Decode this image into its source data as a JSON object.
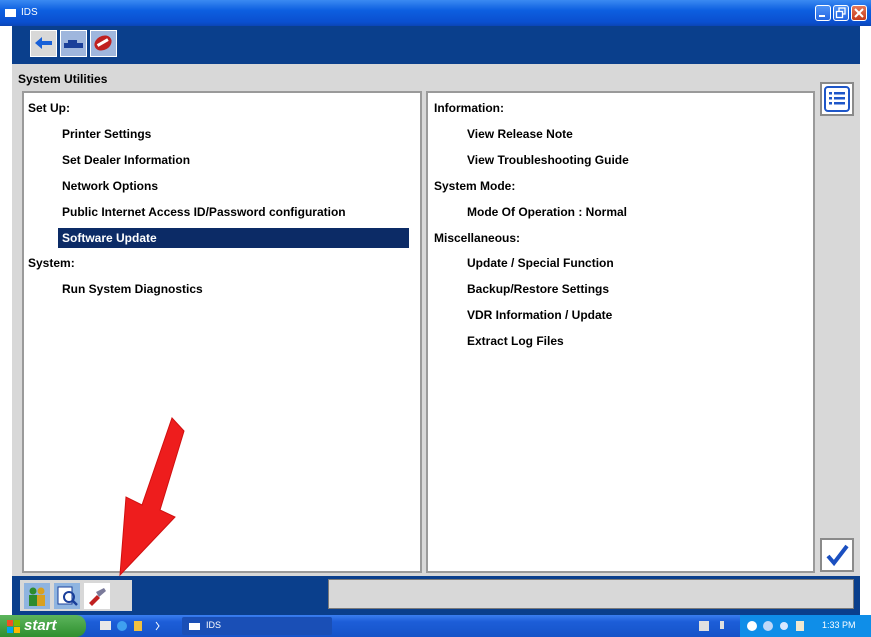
{
  "window": {
    "title": "IDS"
  },
  "toolbar": {
    "icons": [
      "connect-icon",
      "vehicle-icon",
      "tools-icon"
    ]
  },
  "page": {
    "heading": "System Utilities"
  },
  "left_panel": {
    "items": [
      {
        "label": "Set Up:",
        "type": "category"
      },
      {
        "label": "Printer Settings",
        "type": "item"
      },
      {
        "label": "Set Dealer Information",
        "type": "item"
      },
      {
        "label": "Network Options",
        "type": "item"
      },
      {
        "label": "Public Internet Access ID/Password configuration",
        "type": "item"
      },
      {
        "label": "Software Update",
        "type": "item",
        "selected": true
      },
      {
        "label": "System:",
        "type": "category"
      },
      {
        "label": "Run System Diagnostics",
        "type": "item"
      }
    ]
  },
  "right_panel": {
    "items": [
      {
        "label": "Information:",
        "type": "category"
      },
      {
        "label": "View Release Note",
        "type": "item"
      },
      {
        "label": "View Troubleshooting Guide",
        "type": "item"
      },
      {
        "label": "System Mode:",
        "type": "category"
      },
      {
        "label": "Mode Of Operation : Normal",
        "type": "item"
      },
      {
        "label": "Miscellaneous:",
        "type": "category"
      },
      {
        "label": "Update / Special Function",
        "type": "item"
      },
      {
        "label": "Backup/Restore Settings",
        "type": "item"
      },
      {
        "label": "VDR Information / Update",
        "type": "item"
      },
      {
        "label": "Extract Log Files",
        "type": "item"
      }
    ]
  },
  "taskbar": {
    "start_label": "start",
    "task_label": "IDS",
    "clock": "1:33 PM"
  },
  "colors": {
    "accent": "#0a3f8c",
    "selection": "#0c2b66",
    "arrow": "#ee1d1d"
  }
}
